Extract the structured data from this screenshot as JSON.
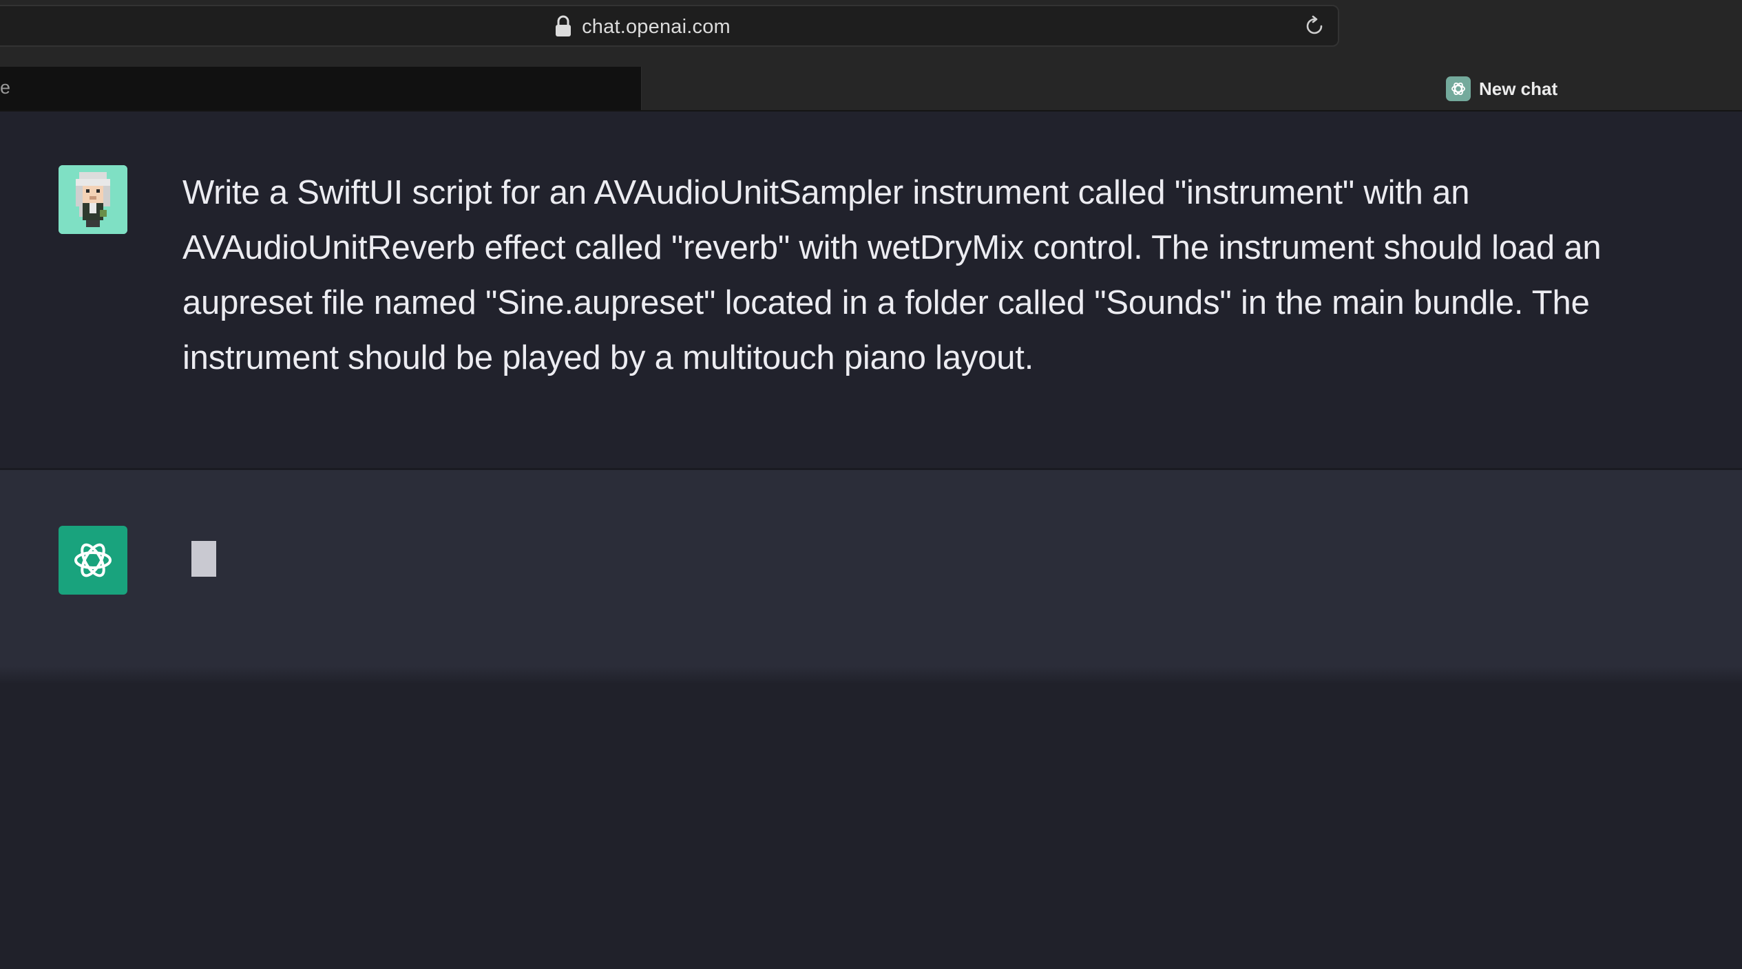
{
  "browser": {
    "url": "chat.openai.com",
    "left_tab_label": "e",
    "active_tab_title": "New chat",
    "lock_icon": "lock-icon",
    "reload_icon": "reload-icon"
  },
  "conversation": {
    "user_message": "Write a SwiftUI script for an AVAudioUnitSampler instrument called \"instrument\" with an AVAudioUnitReverb effect called \"reverb\" with wetDryMix control. The instrument should load an aupreset file named \"Sine.aupreset\" located in a folder called \"Sounds\" in the main bundle. The instrument should be played by a multitouch piano layout.",
    "user_avatar": "pixel-art-avatar",
    "assistant_avatar": "openai-logo-icon",
    "assistant_state": "typing-cursor"
  },
  "colors": {
    "assistant_avatar_bg": "#19a37d",
    "user_avatar_bg": "#7fe0c4",
    "user_row_bg": "#21222c",
    "assistant_row_bg": "#2b2d39",
    "text": "#ececf1"
  }
}
